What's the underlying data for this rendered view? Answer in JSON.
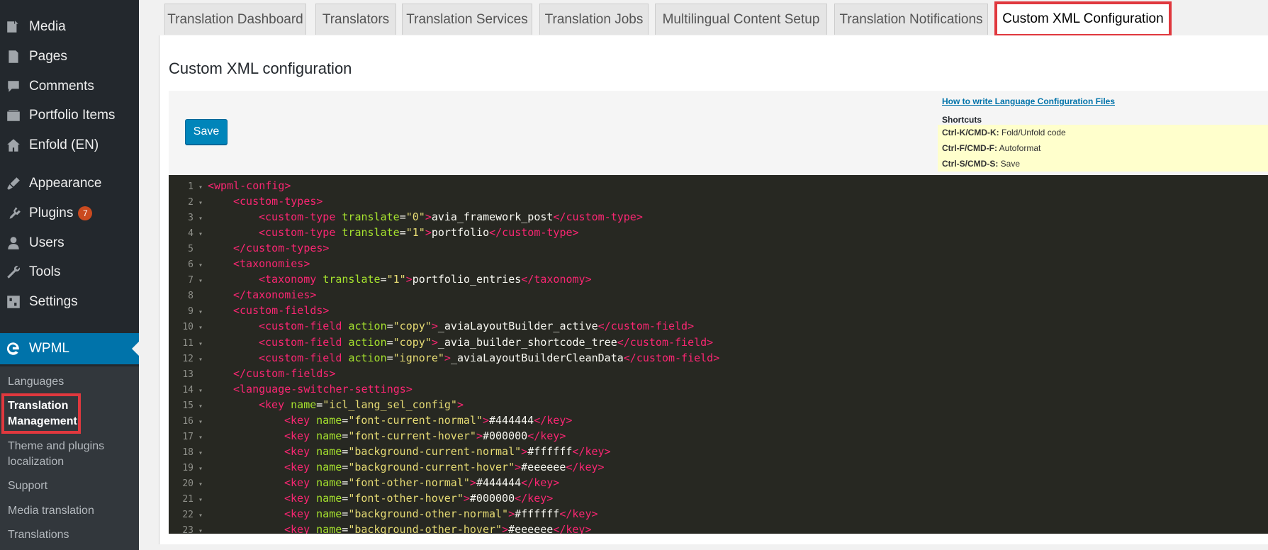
{
  "sidebar": {
    "items": [
      {
        "label": "Media",
        "icon": "media-icon"
      },
      {
        "label": "Pages",
        "icon": "pages-icon"
      },
      {
        "label": "Comments",
        "icon": "comments-icon"
      },
      {
        "label": "Portfolio Items",
        "icon": "portfolio-icon"
      },
      {
        "label": "Enfold (EN)",
        "icon": "home-icon"
      },
      {
        "label": "Appearance",
        "icon": "appearance-icon"
      },
      {
        "label": "Plugins",
        "icon": "plugins-icon",
        "badge": "7"
      },
      {
        "label": "Users",
        "icon": "users-icon"
      },
      {
        "label": "Tools",
        "icon": "tools-icon"
      },
      {
        "label": "Settings",
        "icon": "settings-icon"
      },
      {
        "label": "WPML",
        "icon": "wpml-icon"
      }
    ],
    "submenu": [
      "Languages",
      "Translation Management",
      "Theme and plugins localization",
      "Support",
      "Media translation",
      "Translations"
    ]
  },
  "tabs": [
    "Translation Dashboard",
    "Translators",
    "Translation Services",
    "Translation Jobs",
    "Multilingual Content Setup",
    "Translation Notifications",
    "Custom XML Configuration"
  ],
  "panel": {
    "title": "Custom XML configuration",
    "save_label": "Save",
    "help_link": "How to write Language Configuration Files",
    "shortcuts_title": "Shortcuts",
    "shortcuts": [
      {
        "keys": "Ctrl-K/CMD-K:",
        "desc": " Fold/Unfold code"
      },
      {
        "keys": "Ctrl-F/CMD-F:",
        "desc": " Autoformat"
      },
      {
        "keys": "Ctrl-S/CMD-S:",
        "desc": " Save"
      }
    ]
  },
  "colors": {
    "accent": "#0073aa",
    "highlight": "#e0383e",
    "editor_bg": "#272822"
  },
  "code_lines": [
    {
      "n": "1",
      "fold": true,
      "indent": 0,
      "parts": [
        [
          "tag",
          "<wpml-config>"
        ]
      ]
    },
    {
      "n": "2",
      "fold": true,
      "indent": 1,
      "parts": [
        [
          "tag",
          "<custom-types>"
        ]
      ]
    },
    {
      "n": "3",
      "fold": true,
      "indent": 2,
      "parts": [
        [
          "tag",
          "<custom-type "
        ],
        [
          "attr",
          "translate"
        ],
        [
          "txt",
          "="
        ],
        [
          "val",
          "\"0\""
        ],
        [
          "tag",
          ">"
        ],
        [
          "txt",
          "avia_framework_post"
        ],
        [
          "tag",
          "</custom-type>"
        ]
      ]
    },
    {
      "n": "4",
      "fold": true,
      "indent": 2,
      "parts": [
        [
          "tag",
          "<custom-type "
        ],
        [
          "attr",
          "translate"
        ],
        [
          "txt",
          "="
        ],
        [
          "val",
          "\"1\""
        ],
        [
          "tag",
          ">"
        ],
        [
          "txt",
          "portfolio"
        ],
        [
          "tag",
          "</custom-type>"
        ]
      ]
    },
    {
      "n": "5",
      "fold": false,
      "indent": 1,
      "parts": [
        [
          "tag",
          "</custom-types>"
        ]
      ]
    },
    {
      "n": "6",
      "fold": true,
      "indent": 1,
      "parts": [
        [
          "tag",
          "<taxonomies>"
        ]
      ]
    },
    {
      "n": "7",
      "fold": true,
      "indent": 2,
      "parts": [
        [
          "tag",
          "<taxonomy "
        ],
        [
          "attr",
          "translate"
        ],
        [
          "txt",
          "="
        ],
        [
          "val",
          "\"1\""
        ],
        [
          "tag",
          ">"
        ],
        [
          "txt",
          "portfolio_entries"
        ],
        [
          "tag",
          "</taxonomy>"
        ]
      ]
    },
    {
      "n": "8",
      "fold": false,
      "indent": 1,
      "parts": [
        [
          "tag",
          "</taxonomies>"
        ]
      ]
    },
    {
      "n": "9",
      "fold": true,
      "indent": 1,
      "parts": [
        [
          "tag",
          "<custom-fields>"
        ]
      ]
    },
    {
      "n": "10",
      "fold": true,
      "indent": 2,
      "parts": [
        [
          "tag",
          "<custom-field "
        ],
        [
          "attr",
          "action"
        ],
        [
          "txt",
          "="
        ],
        [
          "val",
          "\"copy\""
        ],
        [
          "tag",
          ">"
        ],
        [
          "txt",
          "_aviaLayoutBuilder_active"
        ],
        [
          "tag",
          "</custom-field>"
        ]
      ]
    },
    {
      "n": "11",
      "fold": true,
      "indent": 2,
      "parts": [
        [
          "tag",
          "<custom-field "
        ],
        [
          "attr",
          "action"
        ],
        [
          "txt",
          "="
        ],
        [
          "val",
          "\"copy\""
        ],
        [
          "tag",
          ">"
        ],
        [
          "txt",
          "_avia_builder_shortcode_tree"
        ],
        [
          "tag",
          "</custom-field>"
        ]
      ]
    },
    {
      "n": "12",
      "fold": true,
      "indent": 2,
      "parts": [
        [
          "tag",
          "<custom-field "
        ],
        [
          "attr",
          "action"
        ],
        [
          "txt",
          "="
        ],
        [
          "val",
          "\"ignore\""
        ],
        [
          "tag",
          ">"
        ],
        [
          "txt",
          "_aviaLayoutBuilderCleanData"
        ],
        [
          "tag",
          "</custom-field>"
        ]
      ]
    },
    {
      "n": "13",
      "fold": false,
      "indent": 1,
      "parts": [
        [
          "tag",
          "</custom-fields>"
        ]
      ]
    },
    {
      "n": "14",
      "fold": true,
      "indent": 1,
      "parts": [
        [
          "tag",
          "<language-switcher-settings>"
        ]
      ]
    },
    {
      "n": "15",
      "fold": true,
      "indent": 2,
      "parts": [
        [
          "tag",
          "<key "
        ],
        [
          "attr",
          "name"
        ],
        [
          "txt",
          "="
        ],
        [
          "val",
          "\"icl_lang_sel_config\""
        ],
        [
          "tag",
          ">"
        ]
      ]
    },
    {
      "n": "16",
      "fold": true,
      "indent": 3,
      "parts": [
        [
          "tag",
          "<key "
        ],
        [
          "attr",
          "name"
        ],
        [
          "txt",
          "="
        ],
        [
          "val",
          "\"font-current-normal\""
        ],
        [
          "tag",
          ">"
        ],
        [
          "txt",
          "#444444"
        ],
        [
          "tag",
          "</key>"
        ]
      ]
    },
    {
      "n": "17",
      "fold": true,
      "indent": 3,
      "parts": [
        [
          "tag",
          "<key "
        ],
        [
          "attr",
          "name"
        ],
        [
          "txt",
          "="
        ],
        [
          "val",
          "\"font-current-hover\""
        ],
        [
          "tag",
          ">"
        ],
        [
          "txt",
          "#000000"
        ],
        [
          "tag",
          "</key>"
        ]
      ]
    },
    {
      "n": "18",
      "fold": true,
      "indent": 3,
      "parts": [
        [
          "tag",
          "<key "
        ],
        [
          "attr",
          "name"
        ],
        [
          "txt",
          "="
        ],
        [
          "val",
          "\"background-current-normal\""
        ],
        [
          "tag",
          ">"
        ],
        [
          "txt",
          "#ffffff"
        ],
        [
          "tag",
          "</key>"
        ]
      ]
    },
    {
      "n": "19",
      "fold": true,
      "indent": 3,
      "parts": [
        [
          "tag",
          "<key "
        ],
        [
          "attr",
          "name"
        ],
        [
          "txt",
          "="
        ],
        [
          "val",
          "\"background-current-hover\""
        ],
        [
          "tag",
          ">"
        ],
        [
          "txt",
          "#eeeeee"
        ],
        [
          "tag",
          "</key>"
        ]
      ]
    },
    {
      "n": "20",
      "fold": true,
      "indent": 3,
      "parts": [
        [
          "tag",
          "<key "
        ],
        [
          "attr",
          "name"
        ],
        [
          "txt",
          "="
        ],
        [
          "val",
          "\"font-other-normal\""
        ],
        [
          "tag",
          ">"
        ],
        [
          "txt",
          "#444444"
        ],
        [
          "tag",
          "</key>"
        ]
      ]
    },
    {
      "n": "21",
      "fold": true,
      "indent": 3,
      "parts": [
        [
          "tag",
          "<key "
        ],
        [
          "attr",
          "name"
        ],
        [
          "txt",
          "="
        ],
        [
          "val",
          "\"font-other-hover\""
        ],
        [
          "tag",
          ">"
        ],
        [
          "txt",
          "#000000"
        ],
        [
          "tag",
          "</key>"
        ]
      ]
    },
    {
      "n": "22",
      "fold": true,
      "indent": 3,
      "parts": [
        [
          "tag",
          "<key "
        ],
        [
          "attr",
          "name"
        ],
        [
          "txt",
          "="
        ],
        [
          "val",
          "\"background-other-normal\""
        ],
        [
          "tag",
          ">"
        ],
        [
          "txt",
          "#ffffff"
        ],
        [
          "tag",
          "</key>"
        ]
      ]
    },
    {
      "n": "23",
      "fold": true,
      "indent": 3,
      "parts": [
        [
          "tag",
          "<key "
        ],
        [
          "attr",
          "name"
        ],
        [
          "txt",
          "="
        ],
        [
          "val",
          "\"background-other-hover\""
        ],
        [
          "tag",
          ">"
        ],
        [
          "txt",
          "#eeeeee"
        ],
        [
          "tag",
          "</key>"
        ]
      ]
    }
  ]
}
